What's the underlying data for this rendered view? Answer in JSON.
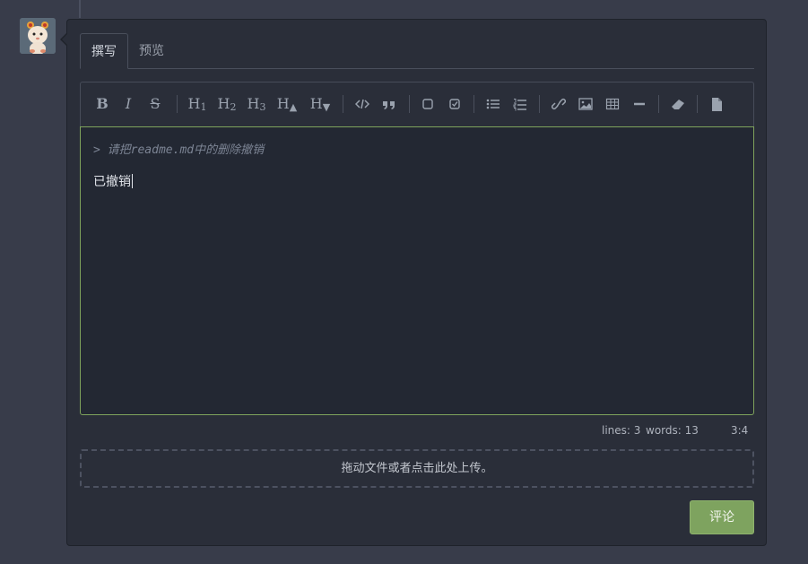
{
  "tabs": {
    "write": "撰写",
    "preview": "预览"
  },
  "toolbar": {
    "bold": "B",
    "italic": "I",
    "strike": "S",
    "h1": "H",
    "h1_sub": "1",
    "h2": "H",
    "h2_sub": "2",
    "h3": "H",
    "h3_sub": "3",
    "h_up": "H",
    "h_up_sub": "▲",
    "h_down": "H",
    "h_down_sub": "▼"
  },
  "editor": {
    "quote": "> 请把readme.md中的删除撤销",
    "text": "已撤销"
  },
  "status": {
    "lines": "lines: 3",
    "words": "words: 13",
    "cursor": "3:4"
  },
  "dropzone": {
    "label": "拖动文件或者点击此处上传。"
  },
  "submit": {
    "label": "评论"
  },
  "colors": {
    "accent": "#7ea35f",
    "editor_border": "#7fa35c",
    "background": "#383c4a"
  }
}
